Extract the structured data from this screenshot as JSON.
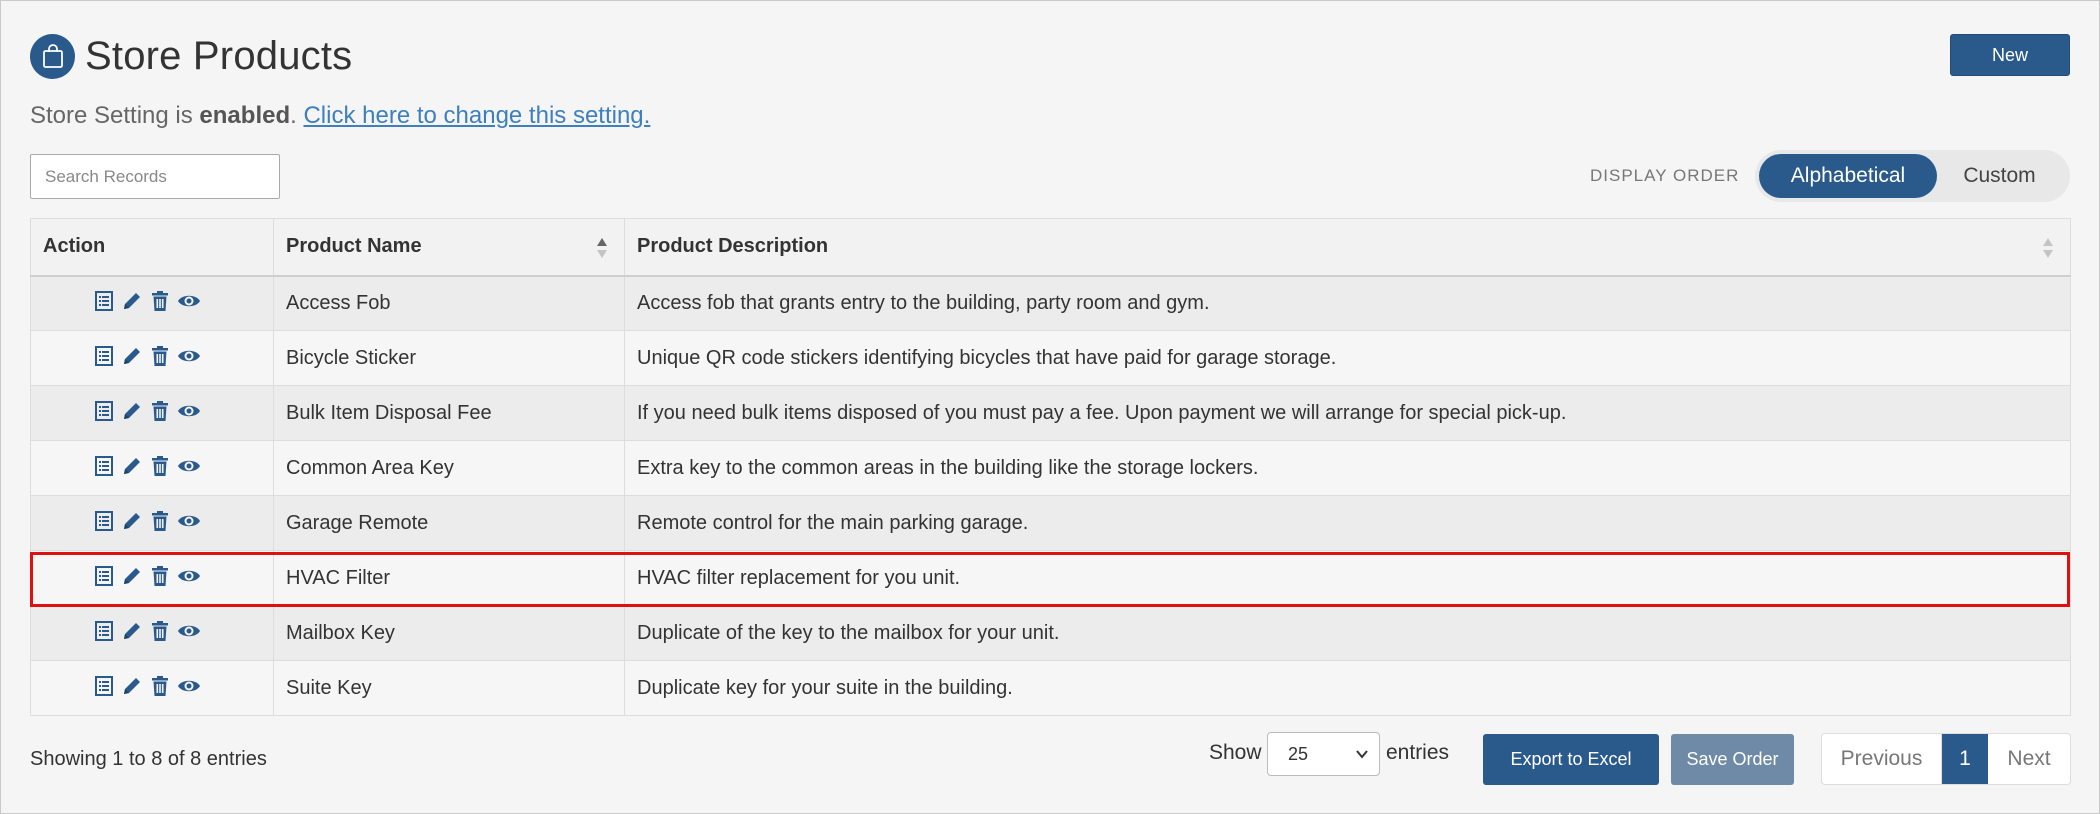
{
  "header": {
    "title": "Store Products",
    "new_label": "New"
  },
  "setting": {
    "prefix": "Store Setting is ",
    "status": "enabled",
    "suffix": ". ",
    "link": "Click here to change this setting."
  },
  "search": {
    "placeholder": "Search Records"
  },
  "display_order": {
    "label": "DISPLAY ORDER",
    "options": [
      "Alphabetical",
      "Custom"
    ],
    "selected": "Alphabetical"
  },
  "table": {
    "columns": [
      "Action",
      "Product Name",
      "Product Description"
    ],
    "rows": [
      {
        "name": "Access Fob",
        "description": "Access fob that grants entry to the building, party room and gym."
      },
      {
        "name": "Bicycle Sticker",
        "description": "Unique QR code stickers identifying bicycles that have paid for garage storage."
      },
      {
        "name": "Bulk Item Disposal Fee",
        "description": "If you need bulk items disposed of you must pay a fee. Upon payment we will arrange for special pick-up."
      },
      {
        "name": "Common Area Key",
        "description": "Extra key to the common areas in the building like the storage lockers."
      },
      {
        "name": "Garage Remote",
        "description": "Remote control for the main parking garage."
      },
      {
        "name": "HVAC Filter",
        "description": "HVAC filter replacement for you unit."
      },
      {
        "name": "Mailbox Key",
        "description": "Duplicate of the key to the mailbox for your unit."
      },
      {
        "name": "Suite Key",
        "description": "Duplicate key for your suite in the building."
      }
    ],
    "highlighted_row": "HVAC Filter"
  },
  "footer": {
    "showing": "Showing 1 to 8 of 8 entries",
    "show_label": "Show",
    "entries_value": "25",
    "entries_label": "entries",
    "export_label": "Export to Excel",
    "save_order_label": "Save Order",
    "prev_label": "Previous",
    "page": "1",
    "next_label": "Next"
  },
  "colors": {
    "primary": "#2a5a8c",
    "highlight": "#e01010",
    "link": "#3d7fbf"
  }
}
